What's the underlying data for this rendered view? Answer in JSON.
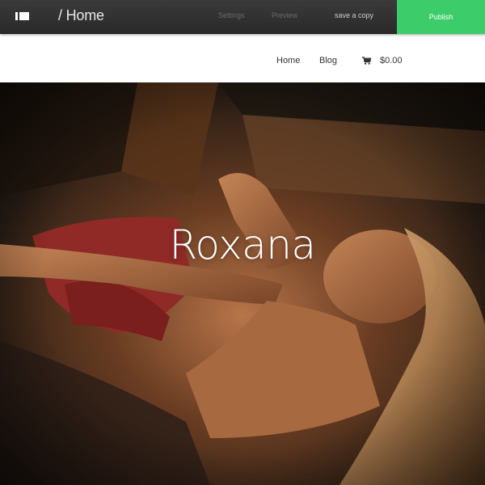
{
  "editor_bar": {
    "breadcrumb": "/ Home",
    "settings_label": "Settings",
    "preview_label": "Preview",
    "save_copy_label": "save a copy",
    "publish_label": "Publish",
    "publish_color": "#3ccd6a"
  },
  "site_nav": {
    "links": [
      {
        "label": "Home"
      },
      {
        "label": "Blog"
      }
    ],
    "cart": {
      "icon": "cart-icon",
      "total": "$0.00"
    }
  },
  "hero": {
    "title": "Roxana"
  }
}
